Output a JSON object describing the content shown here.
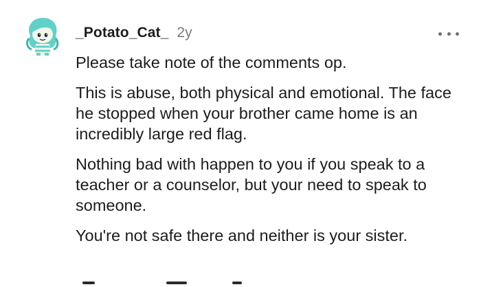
{
  "comment": {
    "author": "_Potato_Cat_",
    "age": "2y",
    "avatar_icon": "mint-haired-snoo-avatar-icon",
    "more_icon": "more-options-icon",
    "paragraphs": [
      "Please take note of the comments op.",
      "This is abuse, both physical and emotional. The face he stopped when your brother came home is an incredibly large red flag.",
      "Nothing bad with happen to you if you speak to a teacher or a counselor, but your need to speak to someone.",
      "You're not safe there and neither is your sister."
    ]
  },
  "colors": {
    "text": "#1c1c1c",
    "muted": "#7c7c7c",
    "avatar_hair": "#5fd1c9",
    "avatar_skin": "#f3f7ea"
  }
}
